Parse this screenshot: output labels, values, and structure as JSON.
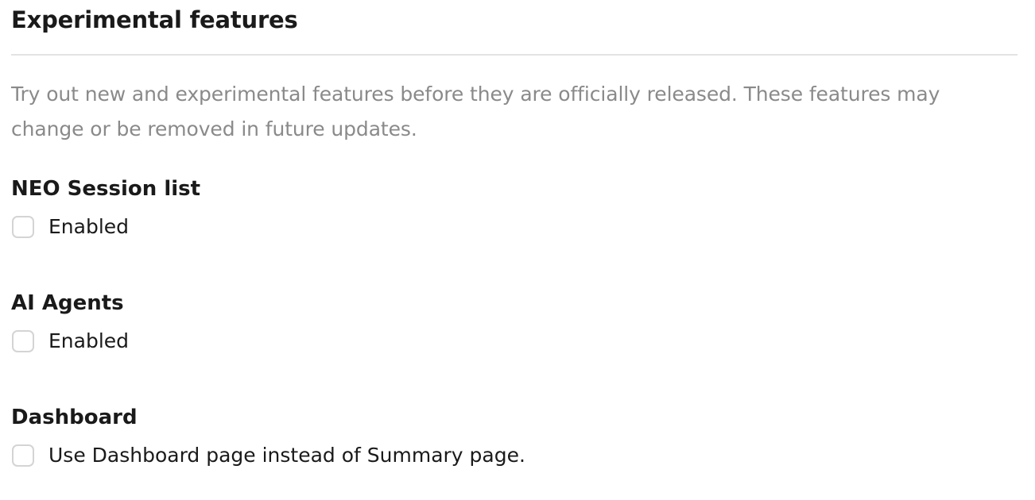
{
  "section": {
    "title": "Experimental features",
    "description": "Try out new and experimental features before they are officially released. These features may change or be removed in future updates."
  },
  "settings": [
    {
      "title": "NEO Session list",
      "checkbox_label": "Enabled",
      "checked": false
    },
    {
      "title": "AI Agents",
      "checkbox_label": "Enabled",
      "checked": false
    },
    {
      "title": "Dashboard",
      "checkbox_label": "Use Dashboard page instead of Summary page.",
      "checked": false
    }
  ],
  "colors": {
    "title_text": "#1a1a1a",
    "description_text": "#8a8a8a",
    "divider": "#e3e3e3",
    "checkbox_border": "#d4d4d4"
  }
}
